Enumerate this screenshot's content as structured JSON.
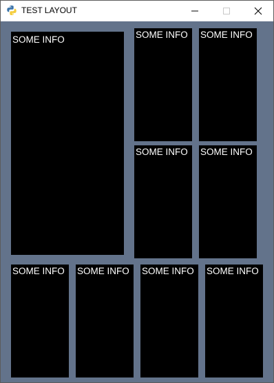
{
  "window": {
    "title": "TEST LAYOUT",
    "icon": "python-icon",
    "controls": [
      "minimize-icon",
      "maximize-icon",
      "close-icon"
    ]
  },
  "colors": {
    "background": "#63738b",
    "panel": "#000000",
    "panel_text": "#ffffff"
  },
  "panels": [
    {
      "label": "SOME INFO"
    },
    {
      "label": "SOME INFO"
    },
    {
      "label": "SOME INFO"
    },
    {
      "label": "SOME INFO"
    },
    {
      "label": "SOME INFO"
    },
    {
      "label": "SOME INFO"
    },
    {
      "label": "SOME INFO"
    },
    {
      "label": "SOME INFO"
    },
    {
      "label": "SOME INFO"
    }
  ]
}
